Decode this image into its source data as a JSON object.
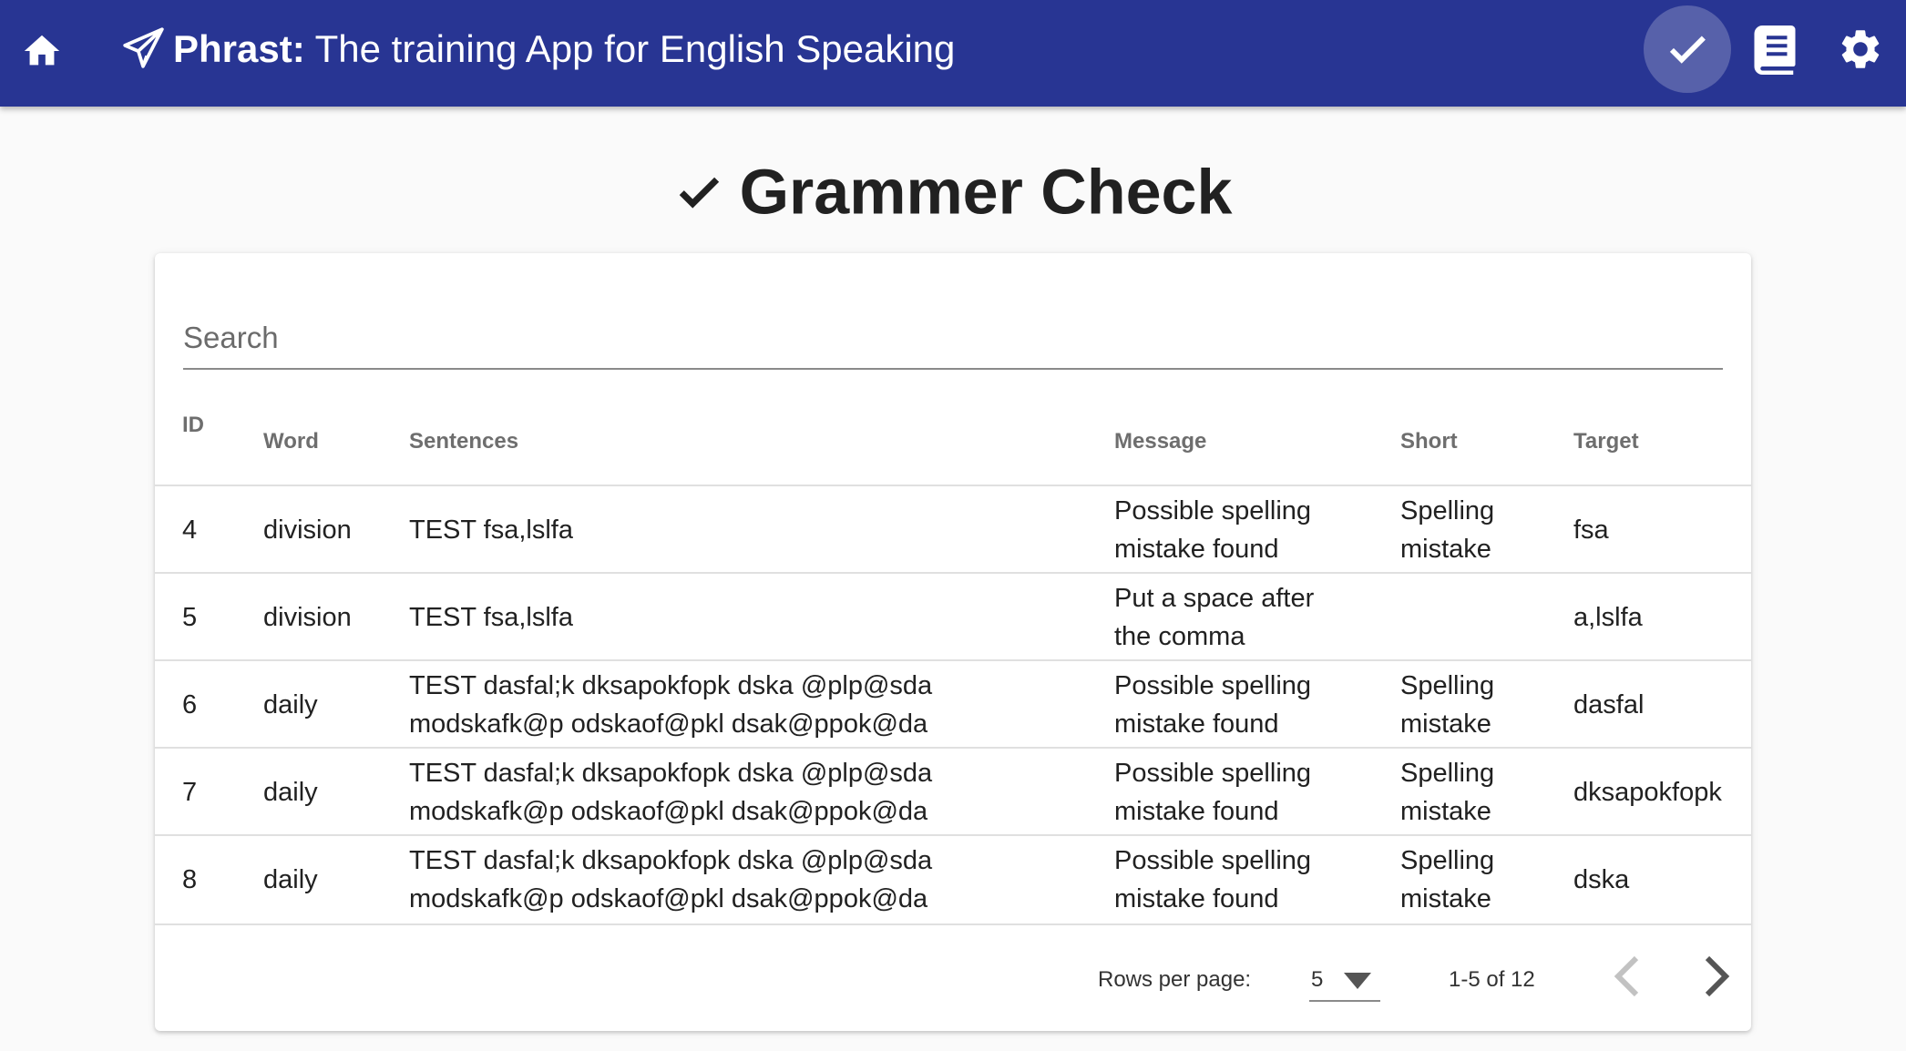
{
  "appbar": {
    "title_bold": "Phrast:",
    "title_rest": " The training App for English Speaking",
    "icons": [
      "home-icon",
      "paper-plane-icon",
      "check-icon",
      "book-icon",
      "gear-icon"
    ],
    "color": "#283593"
  },
  "page": {
    "title": "Grammer Check"
  },
  "search": {
    "placeholder": "Search",
    "value": ""
  },
  "table": {
    "headers": [
      "ID",
      "Word",
      "Sentences",
      "Message",
      "Short",
      "Target"
    ],
    "rows": [
      {
        "id": "4",
        "word": "division",
        "sentence1": "TEST fsa,lslfa",
        "sentence2": "",
        "message1": "Possible spelling",
        "message2": "mistake found",
        "short1": "Spelling",
        "short2": "mistake",
        "target": "fsa"
      },
      {
        "id": "5",
        "word": "division",
        "sentence1": "TEST fsa,lslfa",
        "sentence2": "",
        "message1": "Put a space after",
        "message2": "the comma",
        "short1": "",
        "short2": "",
        "target": "a,lslfa"
      },
      {
        "id": "6",
        "word": "daily",
        "sentence1": "TEST dasfal;k dksapokfopk dska @plp@sda",
        "sentence2": "modskafk@p odskaof@pkl dsak@ppok@da",
        "message1": "Possible spelling",
        "message2": "mistake found",
        "short1": "Spelling",
        "short2": "mistake",
        "target": "dasfal"
      },
      {
        "id": "7",
        "word": "daily",
        "sentence1": "TEST dasfal;k dksapokfopk dska @plp@sda",
        "sentence2": "modskafk@p odskaof@pkl dsak@ppok@da",
        "message1": "Possible spelling",
        "message2": "mistake found",
        "short1": "Spelling",
        "short2": "mistake",
        "target": "dksapokfopk"
      },
      {
        "id": "8",
        "word": "daily",
        "sentence1": "TEST dasfal;k dksapokfopk dska @plp@sda",
        "sentence2": "modskafk@p odskaof@pkl dsak@ppok@da",
        "message1": "Possible spelling",
        "message2": "mistake found",
        "short1": "Spelling",
        "short2": "mistake",
        "target": "dska"
      }
    ]
  },
  "pagination": {
    "rows_per_page_label": "Rows per page:",
    "rows_per_page": "5",
    "range": "1-5 of 12"
  }
}
